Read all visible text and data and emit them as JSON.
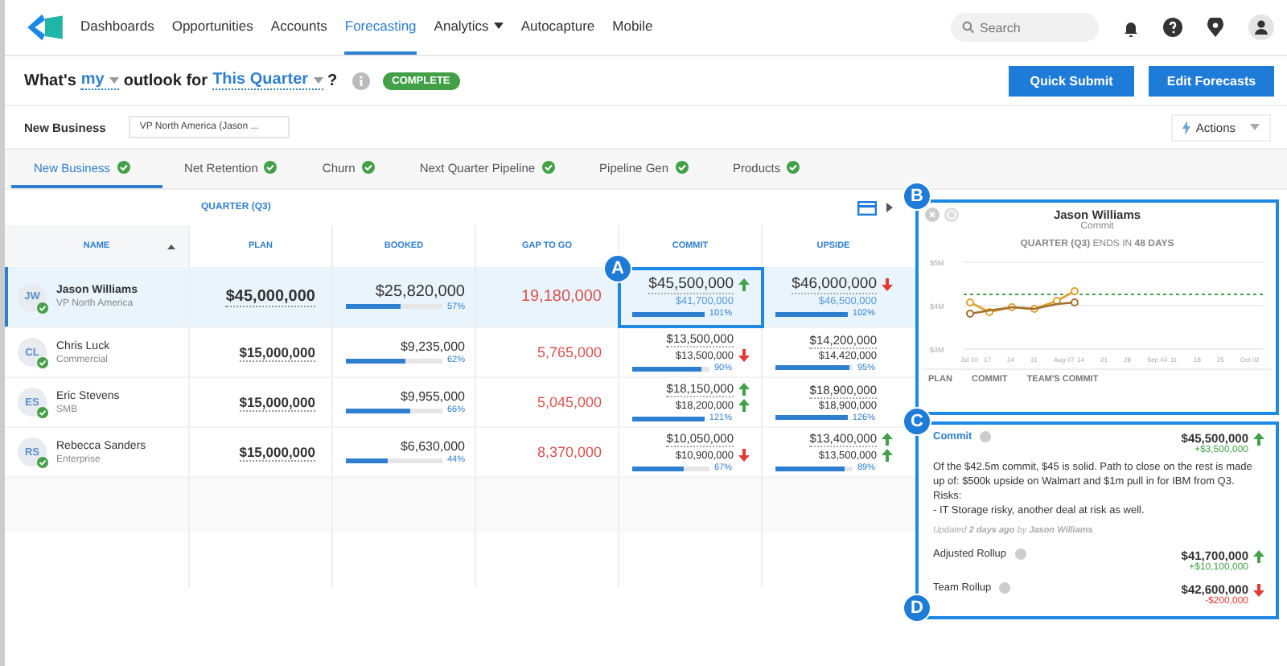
{
  "nav": {
    "links": [
      {
        "label": "Dashboards",
        "selected": false,
        "caret": false
      },
      {
        "label": "Opportunities",
        "selected": false,
        "caret": false
      },
      {
        "label": "Accounts",
        "selected": false,
        "caret": false
      },
      {
        "label": "Forecasting",
        "selected": true,
        "caret": false
      },
      {
        "label": "Analytics",
        "selected": false,
        "caret": true
      },
      {
        "label": "Autocapture",
        "selected": false,
        "caret": false
      },
      {
        "label": "Mobile",
        "selected": false,
        "caret": false
      }
    ],
    "search": {
      "placeholder": "Search"
    }
  },
  "question": {
    "parts": [
      "What's",
      "my",
      "outlook for",
      "This Quarter",
      "?"
    ],
    "status": "COMPLETE"
  },
  "buttons": [
    "Quick Submit",
    "Edit Forecasts"
  ],
  "filters": {
    "business": "New Business",
    "team": "VP North America (Jason ...",
    "actions": "Actions"
  },
  "tabs": [
    {
      "label": "New Business",
      "selected": true,
      "complete": true
    },
    {
      "label": "Net Retention",
      "selected": false,
      "complete": true
    },
    {
      "label": "Churn",
      "selected": false,
      "complete": true
    },
    {
      "label": "Next Quarter Pipeline",
      "selected": false,
      "complete": true
    },
    {
      "label": "Pipeline Gen",
      "selected": false,
      "complete": true
    },
    {
      "label": "Products",
      "selected": false,
      "complete": true
    }
  ],
  "table": {
    "group": "QUARTER (Q3)",
    "columns": [
      "NAME",
      "PLAN",
      "BOOKED",
      "GAP TO GO",
      "COMMIT",
      "UPSIDE"
    ],
    "rows": [
      {
        "initials": "JW",
        "name": "Jason Williams",
        "role": "VP North America",
        "selected": true,
        "plan": "$45,000,000",
        "booked": {
          "value": "$25,820,000",
          "pct": "57%",
          "level": 0.57
        },
        "gap": "19,180,000",
        "commit": {
          "value": "$45,500,000",
          "up": true,
          "down": false,
          "sub": "$41,700,000",
          "sub_up": false,
          "sub_down": false,
          "pct": "101%",
          "level": 1
        },
        "upside": {
          "value": "$46,000,000",
          "up": false,
          "down": true,
          "sub": "$46,500,000",
          "sub_up": false,
          "sub_down": false,
          "pct": "102%",
          "level": 1
        }
      },
      {
        "initials": "CL",
        "name": "Chris Luck",
        "role": "Commercial",
        "selected": false,
        "plan": "$15,000,000",
        "booked": {
          "value": "$9,235,000",
          "pct": "62%",
          "level": 0.62
        },
        "gap": "5,765,000",
        "commit": {
          "value": "$13,500,000",
          "up": false,
          "down": false,
          "sub": "$13,500,000",
          "sub_up": false,
          "sub_down": true,
          "pct": "90%",
          "level": 0.9
        },
        "upside": {
          "value": "$14,200,000",
          "up": false,
          "down": false,
          "sub": "$14,420,000",
          "sub_up": false,
          "sub_down": false,
          "pct": "95%",
          "level": 0.95
        }
      },
      {
        "initials": "ES",
        "name": "Eric Stevens",
        "role": "SMB",
        "selected": false,
        "plan": "$15,000,000",
        "booked": {
          "value": "$9,955,000",
          "pct": "66%",
          "level": 0.66
        },
        "gap": "5,045,000",
        "commit": {
          "value": "$18,150,000",
          "up": true,
          "down": false,
          "sub": "$18,200,000",
          "sub_up": true,
          "sub_down": false,
          "pct": "121%",
          "level": 1
        },
        "upside": {
          "value": "$18,900,000",
          "up": false,
          "down": false,
          "sub": "$18,900,000",
          "sub_up": false,
          "sub_down": false,
          "pct": "126%",
          "level": 1
        }
      },
      {
        "initials": "RS",
        "name": "Rebecca Sanders",
        "role": "Enterprise",
        "selected": false,
        "plan": "$15,000,000",
        "booked": {
          "value": "$6,630,000",
          "pct": "44%",
          "level": 0.44
        },
        "gap": "8,370,000",
        "commit": {
          "value": "$10,050,000",
          "up": false,
          "down": false,
          "sub": "$10,900,000",
          "sub_up": false,
          "sub_down": true,
          "pct": "67%",
          "level": 0.67
        },
        "upside": {
          "value": "$13,400,000",
          "up": true,
          "down": false,
          "sub": "$13,500,000",
          "sub_up": true,
          "sub_down": false,
          "pct": "89%",
          "level": 0.89
        }
      }
    ]
  },
  "panel": {
    "name": "Jason Williams",
    "subtitle": "Commit",
    "period": "**QUARTER (Q3)** ENDS IN **48 DAYS**",
    "chart": {
      "yticks": [
        "$5M",
        "$4M",
        "$3M"
      ],
      "xlabels": [
        "Jul 10",
        "17",
        "24",
        "31",
        "Aug 07",
        "14",
        "21",
        "28",
        "Sep 04",
        "11",
        "18",
        "25",
        "Oct 02"
      ],
      "legend": [
        "PLAN",
        "COMMIT",
        "TEAM'S COMMIT"
      ]
    },
    "commit": {
      "label": "Commit",
      "value": "$45,500,000",
      "up": true,
      "down": false,
      "delta": "+$3,500,000",
      "note": [
        "Of the $42.5m commit, $45 is solid.  Path to close on the rest is made up of: $500k upside on Walmart and $1m pull in for IBM from Q3.",
        "Risks:",
        "- IT Storage risky, another deal at risk as well."
      ],
      "updated": "Updated **2 days ago** by **Jason Williams**"
    },
    "rollups": [
      {
        "label": "Adjusted Rollup",
        "value": "$41,700,000",
        "up": true,
        "down": false,
        "delta": "+$10,100,000"
      },
      {
        "label": "Team Rollup",
        "value": "$42,600,000",
        "up": false,
        "down": true,
        "delta": "-$200,000"
      }
    ]
  },
  "callouts": [
    "A",
    "B",
    "C",
    "D"
  ]
}
